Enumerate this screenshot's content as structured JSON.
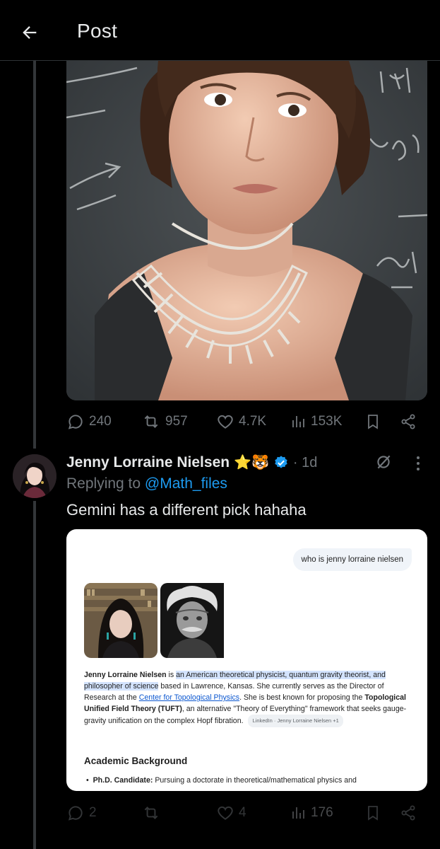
{
  "header": {
    "title": "Post"
  },
  "original_post": {
    "stats": {
      "replies": "240",
      "reposts": "957",
      "likes": "4.7K",
      "views": "153K"
    }
  },
  "reply": {
    "author": {
      "name": "Jenny Lorraine Nielsen",
      "emojis": "⭐🐯",
      "time": "· 1d"
    },
    "replying_to_label": "Replying to",
    "replying_to_handle": "@Math_files",
    "text": "Gemini has a different pick hahaha",
    "stats": {
      "replies": "2",
      "reposts": "",
      "likes": "4",
      "views": "176"
    },
    "embedded_screenshot": {
      "query": "who is jenny lorraine nielsen",
      "answer_name": "Jenny Lorraine Nielsen",
      "answer_is": "is",
      "answer_highlight": "an American theoretical physicist, quantum gravity theorist, and philosopher of science",
      "answer_p1": "based in Lawrence, Kansas. She currently serves as the Director of Research at the",
      "answer_link": "Center for Topological Physics",
      "answer_p2": ". She is best known for proposing the",
      "answer_bold": "Topological Unified Field Theory (TUFT)",
      "answer_p3": ", an alternative \"Theory of Everything\" framework that seeks gauge-gravity unification on the complex Hopf fibration.",
      "source_chip": "LinkedIn · Jenny Lorraine Nielsen +1",
      "section_heading": "Academic Background",
      "bullet_label": "Ph.D. Candidate:",
      "bullet_text": "Pursuing a doctorate in theoretical/mathematical physics and"
    }
  },
  "colors": {
    "background": "#000000",
    "text": "#e7e9ea",
    "muted": "#71767b",
    "accent": "#1d9bf0",
    "divider": "#2f3336"
  }
}
